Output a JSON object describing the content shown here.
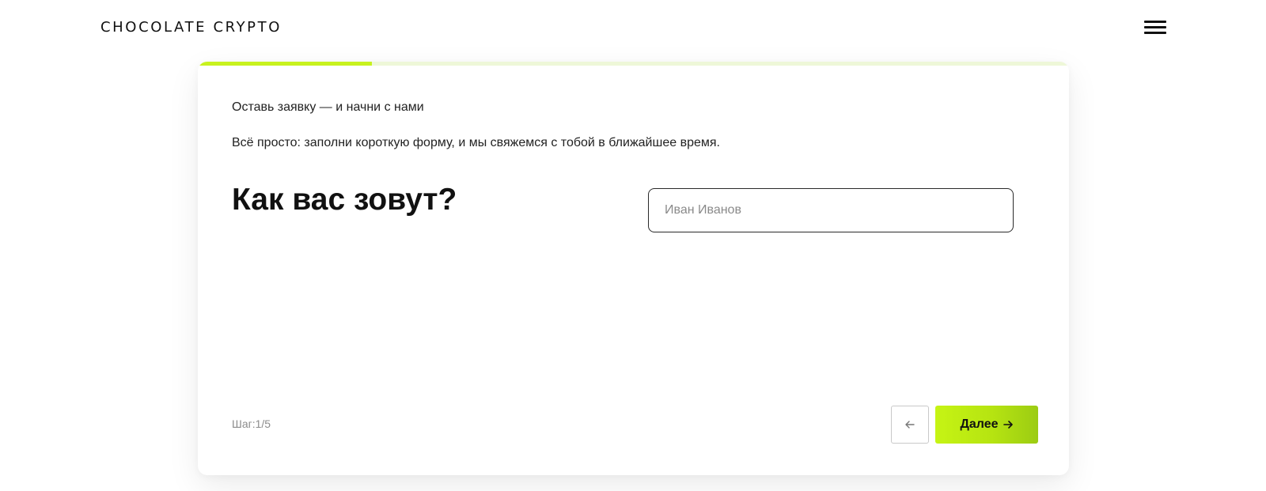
{
  "header": {
    "logo_text": "CHOCOLATE CRYPTO"
  },
  "form": {
    "progress_percent": 20,
    "intro_title": "Оставь заявку — и начни с нами",
    "intro_text": "Всё просто: заполни короткую форму, и мы свяжемся с тобой в ближайшее время.",
    "question": "Как вас зовут?",
    "name_input": {
      "value": "",
      "placeholder": "Иван Иванов"
    },
    "step_label": "Шаг:1/5",
    "back_icon": "arrow-left-icon",
    "next_label": "Далее",
    "next_icon": "arrow-right-icon"
  },
  "colors": {
    "accent": "#c6f414",
    "accent_dark": "#9ccc13",
    "progress_track": "#eef7d8"
  }
}
